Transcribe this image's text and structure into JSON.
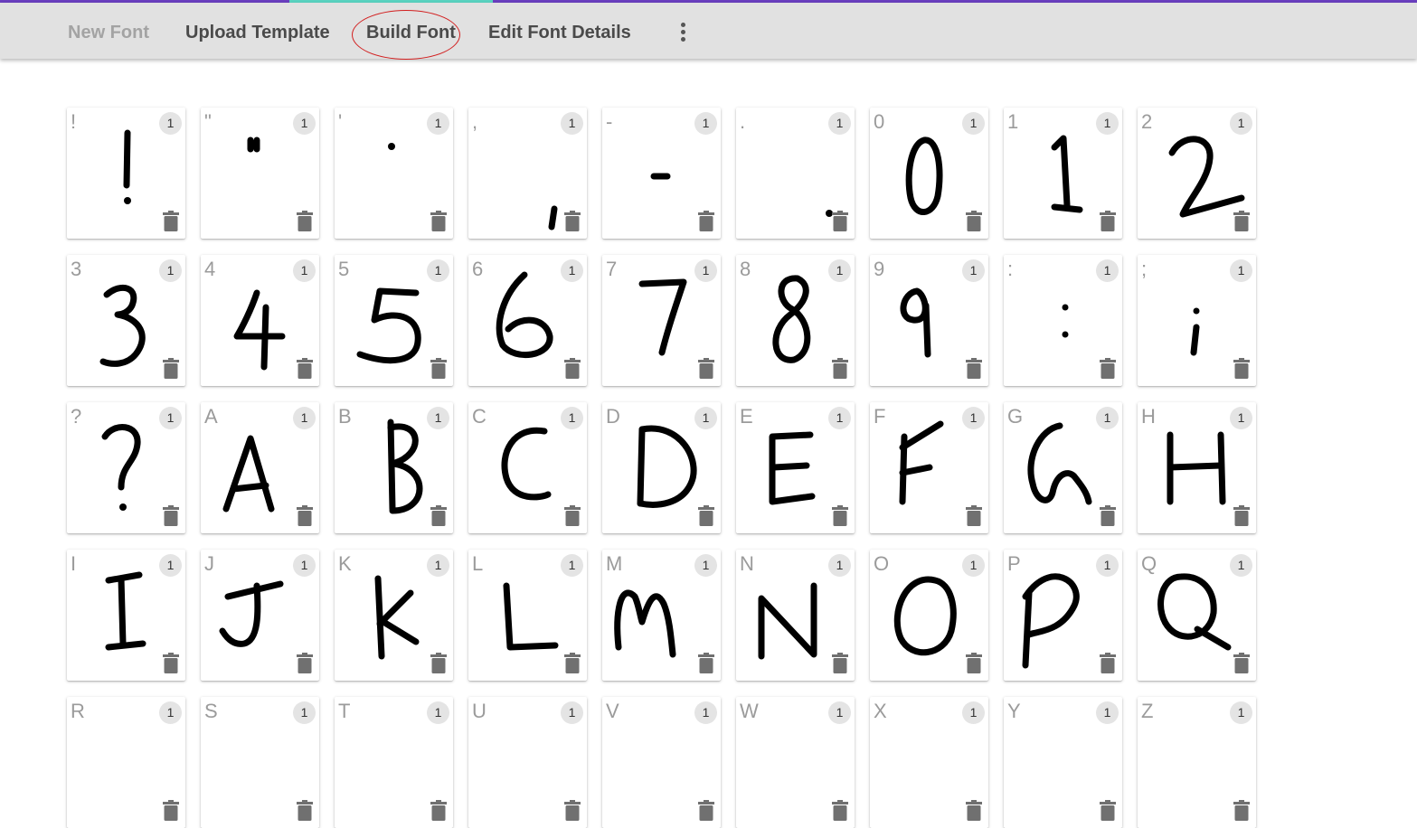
{
  "toolbar": {
    "new_font": "New Font",
    "upload_template": "Upload Template",
    "build_font": "Build Font",
    "edit_font_details": "Edit Font Details",
    "more_icon": "more-vert-icon"
  },
  "colors": {
    "accent_purple": "#6a3fbf",
    "accent_teal": "#5ad3c0",
    "annotation_red": "#d21f1f"
  },
  "glyphs": [
    {
      "char": "!",
      "count": "1"
    },
    {
      "char": "\"",
      "count": "1"
    },
    {
      "char": "'",
      "count": "1"
    },
    {
      "char": ",",
      "count": "1"
    },
    {
      "char": "-",
      "count": "1"
    },
    {
      "char": ".",
      "count": "1"
    },
    {
      "char": "0",
      "count": "1"
    },
    {
      "char": "1",
      "count": "1"
    },
    {
      "char": "2",
      "count": "1"
    },
    {
      "char": "3",
      "count": "1"
    },
    {
      "char": "4",
      "count": "1"
    },
    {
      "char": "5",
      "count": "1"
    },
    {
      "char": "6",
      "count": "1"
    },
    {
      "char": "7",
      "count": "1"
    },
    {
      "char": "8",
      "count": "1"
    },
    {
      "char": "9",
      "count": "1"
    },
    {
      "char": ":",
      "count": "1"
    },
    {
      "char": ";",
      "count": "1"
    },
    {
      "char": "?",
      "count": "1"
    },
    {
      "char": "A",
      "count": "1"
    },
    {
      "char": "B",
      "count": "1"
    },
    {
      "char": "C",
      "count": "1"
    },
    {
      "char": "D",
      "count": "1"
    },
    {
      "char": "E",
      "count": "1"
    },
    {
      "char": "F",
      "count": "1"
    },
    {
      "char": "G",
      "count": "1"
    },
    {
      "char": "H",
      "count": "1"
    },
    {
      "char": "I",
      "count": "1"
    },
    {
      "char": "J",
      "count": "1"
    },
    {
      "char": "K",
      "count": "1"
    },
    {
      "char": "L",
      "count": "1"
    },
    {
      "char": "M",
      "count": "1"
    },
    {
      "char": "N",
      "count": "1"
    },
    {
      "char": "O",
      "count": "1"
    },
    {
      "char": "P",
      "count": "1"
    },
    {
      "char": "Q",
      "count": "1"
    },
    {
      "char": "R",
      "count": "1"
    },
    {
      "char": "S",
      "count": "1"
    },
    {
      "char": "T",
      "count": "1"
    },
    {
      "char": "U",
      "count": "1"
    },
    {
      "char": "V",
      "count": "1"
    },
    {
      "char": "W",
      "count": "1"
    },
    {
      "char": "X",
      "count": "1"
    },
    {
      "char": "Y",
      "count": "1"
    },
    {
      "char": "Z",
      "count": "1"
    }
  ]
}
